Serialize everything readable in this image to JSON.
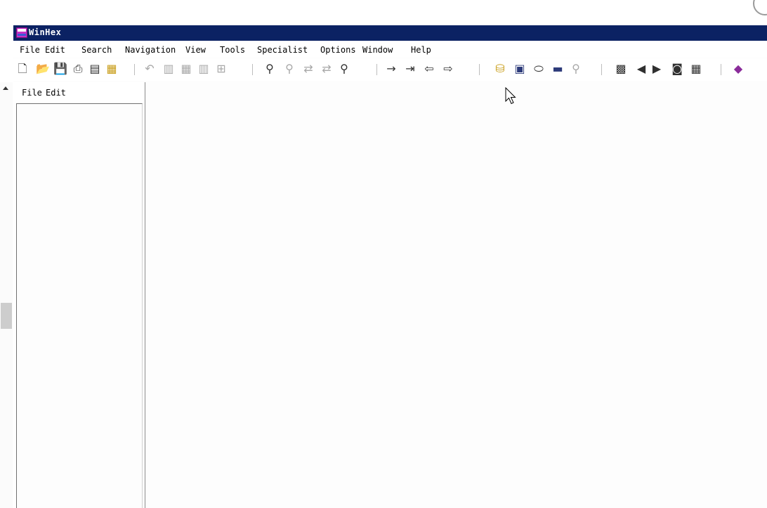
{
  "window": {
    "title": "WinHex"
  },
  "menubar": {
    "items": [
      "File",
      "Edit",
      "Search",
      "Navigation",
      "View",
      "Tools",
      "Specialist",
      "Options",
      "Window",
      "Help"
    ]
  },
  "toolbar": {
    "icons": [
      "new-file-icon",
      "open-folder-icon",
      "save-icon",
      "print-icon",
      "properties-icon",
      "exit-icon",
      "undo-icon",
      "cut-icon",
      "copy-icon",
      "paste-icon",
      "write-block-icon",
      "find-text-icon",
      "find-hex-icon",
      "replace-text-icon",
      "replace-hex-icon",
      "find-next-icon",
      "goto-offset-icon",
      "goto-page-icon",
      "back-icon",
      "forward-icon",
      "open-disk-icon",
      "edit-ram-icon",
      "ram-icon",
      "calculator-icon",
      "hash-icon",
      "analyze-icon",
      "previous-icon",
      "next-icon",
      "snapshot-icon",
      "table-icon",
      "help-book-icon"
    ]
  },
  "side_panel": {
    "menu": [
      "File",
      "Edit"
    ]
  }
}
